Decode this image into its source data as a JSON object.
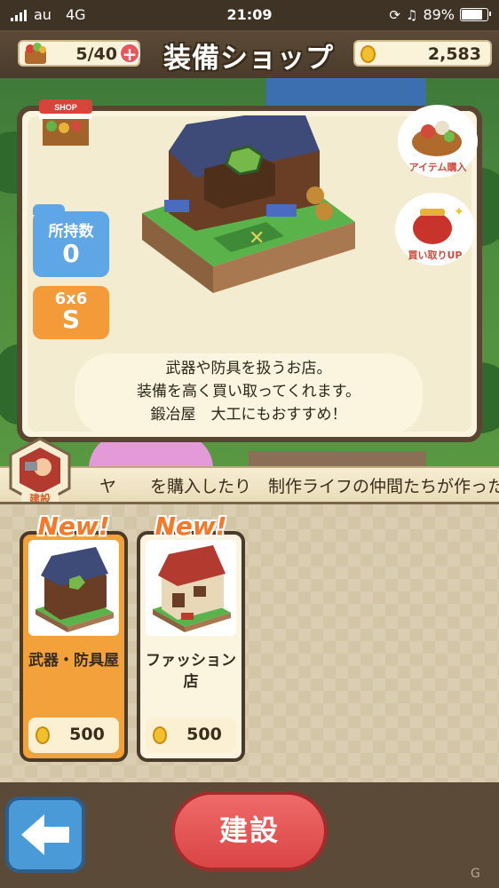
{
  "status_bar": {
    "carrier": "au",
    "network": "4G",
    "time": "21:09",
    "battery": "89%"
  },
  "header": {
    "title": "装備ショップ",
    "inventory": "5/40",
    "gold": "2,583",
    "icons": [
      "basket-icon",
      "plus-icon",
      "coin-icon"
    ]
  },
  "info": {
    "owned_label": "所持数",
    "owned_value": "0",
    "size": "6x6",
    "rank": "S",
    "desc_line1": "武器や防具を扱うお店。",
    "desc_line2": "装備を高く買い取ってくれます。",
    "desc_line3": "鍛冶屋　大工にもおすすめ！",
    "bubble_buy": "アイテム購入",
    "bubble_sell": "買い取りUP",
    "sign": "SHOP"
  },
  "ticker": {
    "text": "ヤ　　を購入したり　制作ライフの仲間たちが作ったア",
    "badge": "建設"
  },
  "cards": [
    {
      "name": "武器・防具屋",
      "price": "500",
      "new": "New!"
    },
    {
      "name_line1": "ファッション",
      "name_line2": "店",
      "price": "500",
      "new": "New!"
    }
  ],
  "footer": {
    "build": "建設"
  },
  "colors": {
    "accent": "#f3a13b",
    "build": "#e25757",
    "back": "#4b9ad8"
  }
}
